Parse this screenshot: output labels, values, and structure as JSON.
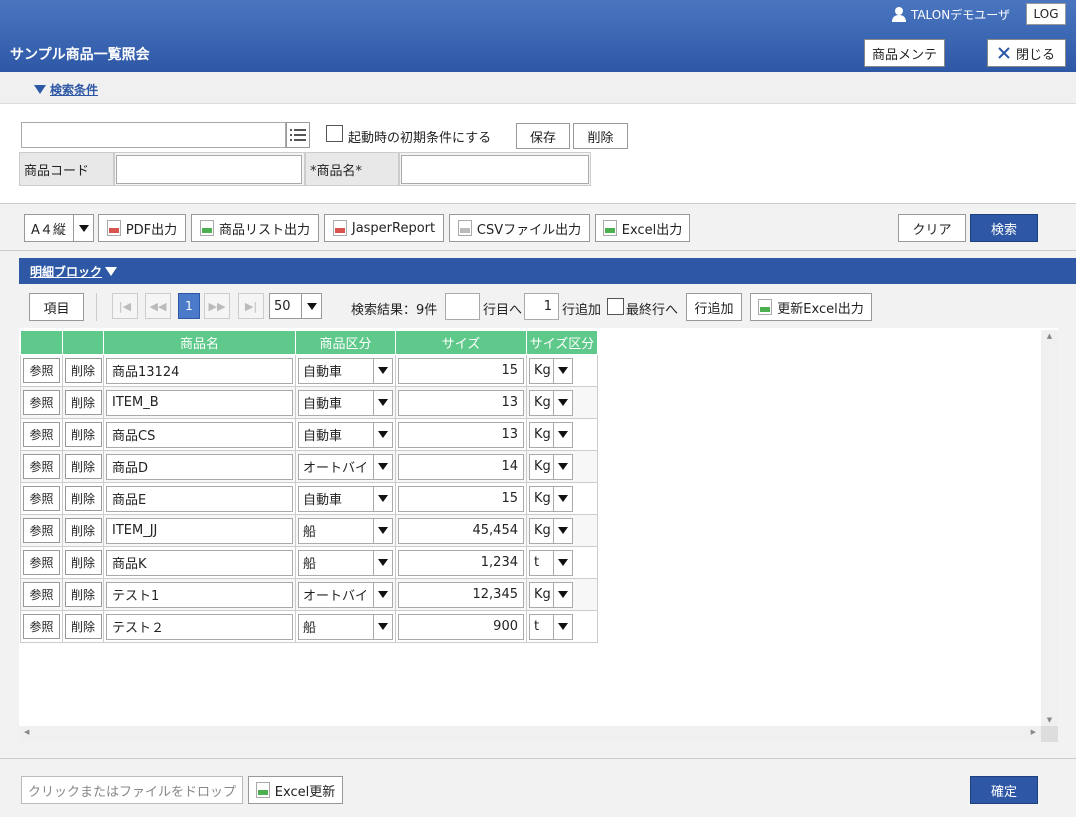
{
  "header": {
    "title": "サンプル商品一覧照会",
    "user": "TALONデモユーザ",
    "log_label": "LOG",
    "maint_label": "商品メンテ",
    "close_label": "閉じる"
  },
  "search": {
    "section_label": "検索条件",
    "startup_label": "起動時の初期条件にする",
    "save_label": "保存",
    "delete_label": "削除",
    "code_label": "商品コード",
    "name_label": "*商品名*"
  },
  "toolbar": {
    "paper": "A４縦",
    "pdf": "PDF出力",
    "list": "商品リスト出力",
    "jasper": "JasperReport",
    "csv": "CSVファイル出力",
    "excel": "Excel出力",
    "clear": "クリア",
    "search": "検索"
  },
  "detail": {
    "section_label": "明細ブロック",
    "items_label": "項目",
    "page": "1",
    "per_page": "50",
    "result": "検索結果：9件",
    "row_to": "行目へ",
    "row_num": "1",
    "row_add_label": "行追加",
    "last_row": "最終行へ",
    "add_row": "行追加",
    "excel_update": "更新Excel出力"
  },
  "table": {
    "headers": [
      "",
      "",
      "商品名",
      "商品区分",
      "サイズ",
      "サイズ区分"
    ],
    "ref_label": "参照",
    "del_label": "削除",
    "rows": [
      {
        "name": "商品13124",
        "category": "自動車",
        "size": "15",
        "unit": "Kg"
      },
      {
        "name": "ITEM_B",
        "category": "自動車",
        "size": "13",
        "unit": "Kg"
      },
      {
        "name": "商品CS",
        "category": "自動車",
        "size": "13",
        "unit": "Kg"
      },
      {
        "name": "商品D",
        "category": "オートバイ",
        "size": "14",
        "unit": "Kg"
      },
      {
        "name": "商品E",
        "category": "自動車",
        "size": "15",
        "unit": "Kg"
      },
      {
        "name": "ITEM_JJ",
        "category": "船",
        "size": "45,454",
        "unit": "Kg"
      },
      {
        "name": "商品K",
        "category": "船",
        "size": "1,234",
        "unit": "t"
      },
      {
        "name": "テスト1",
        "category": "オートバイ",
        "size": "12,345",
        "unit": "Kg"
      },
      {
        "name": "テスト２",
        "category": "船",
        "size": "900",
        "unit": "t"
      }
    ]
  },
  "footer": {
    "drop_label": "クリックまたはファイルをドロップ",
    "excel_update": "Excel更新",
    "confirm": "確定"
  },
  "colors": {
    "header_blue": "#2e58a6",
    "grid_header_green": "#5ec98a"
  }
}
